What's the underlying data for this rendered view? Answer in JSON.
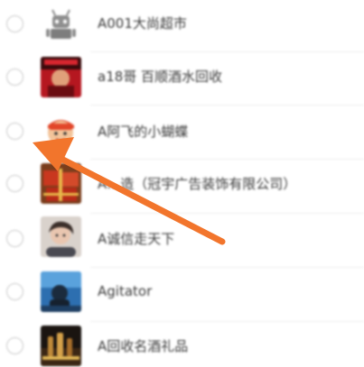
{
  "contacts": [
    {
      "name": "A001大尚超市",
      "avatar_icon": "android-robot-icon"
    },
    {
      "name": "a18哥 百顺酒水回收",
      "avatar_icon": "red-poster-avatar-icon"
    },
    {
      "name": "A阿飞的小蝴蝶",
      "avatar_icon": "cartoon-face-avatar-icon"
    },
    {
      "name": "A…造（冠宇广告装饰有限公司）",
      "avatar_icon": "gift-box-avatar-icon"
    },
    {
      "name": "A诚信走天下",
      "avatar_icon": "person-photo-avatar-icon"
    },
    {
      "name": "Agitator",
      "avatar_icon": "blue-sky-avatar-icon"
    },
    {
      "name": "A回收名酒礼品",
      "avatar_icon": "liquor-bottles-avatar-icon"
    }
  ],
  "annotation": {
    "arrow_color": "#f2752c",
    "arrow_icon": "orange-pointer-arrow-icon"
  },
  "colors": {
    "radio_border": "#c9c9c9",
    "label_text": "#3a3a3a",
    "divider": "#ececec"
  }
}
